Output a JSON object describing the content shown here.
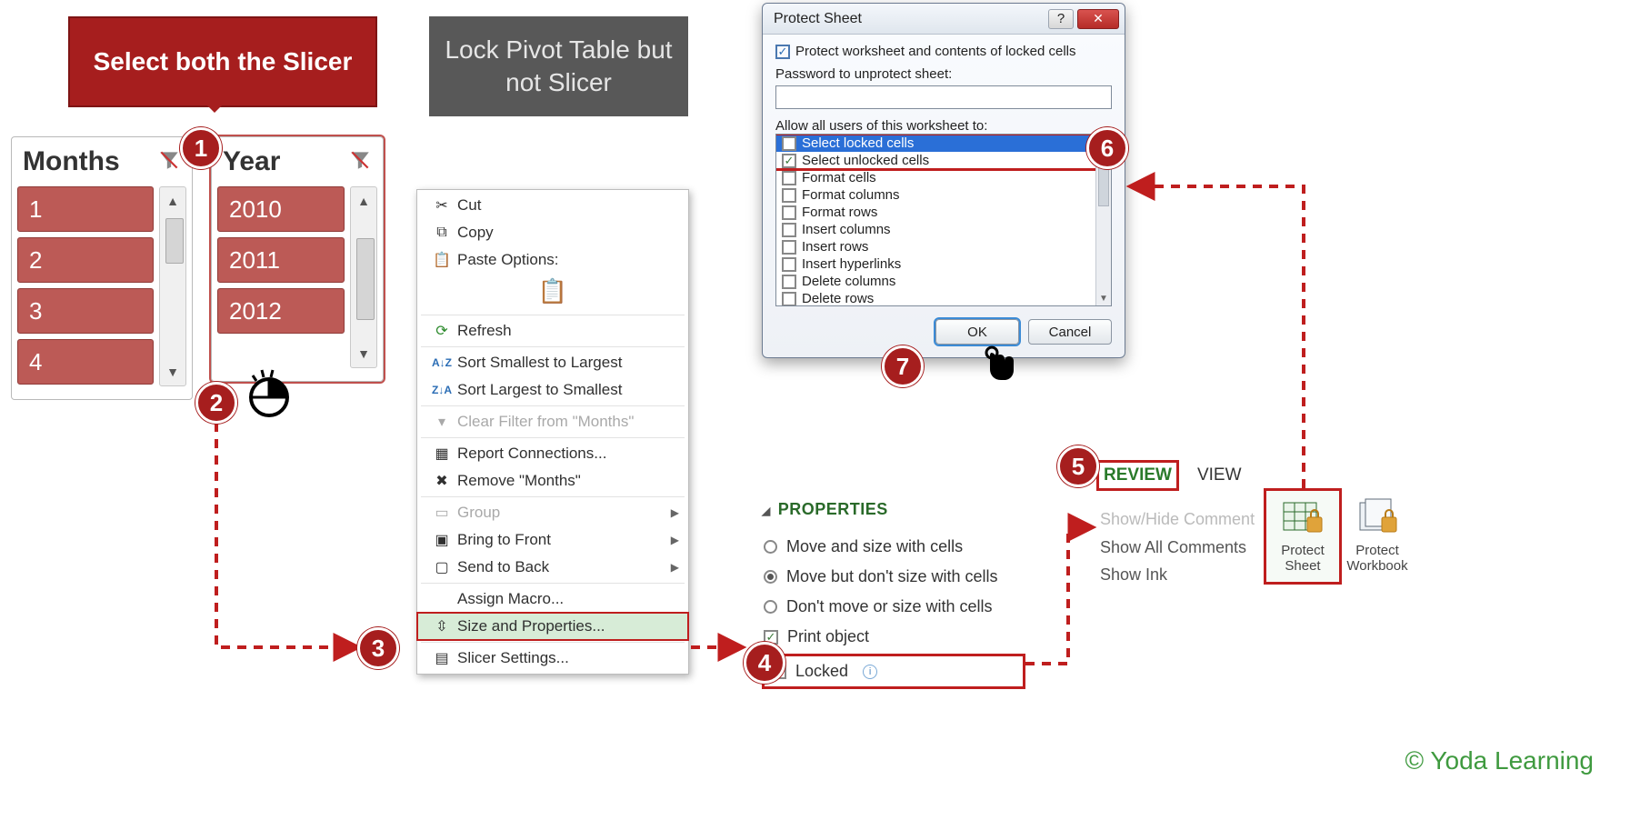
{
  "callout_text": "Select both the Slicer",
  "title_text": "Lock Pivot Table but not Slicer",
  "badges": {
    "b1": "1",
    "b2": "2",
    "b3": "3",
    "b4": "4",
    "b5": "5",
    "b6": "6",
    "b7": "7"
  },
  "slicer_months": {
    "title": "Months",
    "items": [
      "1",
      "2",
      "3",
      "4"
    ]
  },
  "slicer_year": {
    "title": "Year",
    "items": [
      "2010",
      "2011",
      "2012"
    ]
  },
  "context_menu": {
    "cut": "Cut",
    "copy": "Copy",
    "paste_options": "Paste Options:",
    "refresh": "Refresh",
    "sort_asc": "Sort Smallest to Largest",
    "sort_desc": "Sort Largest to Smallest",
    "clear_filter": "Clear Filter from \"Months\"",
    "report_conn": "Report Connections...",
    "remove": "Remove \"Months\"",
    "group": "Group",
    "front": "Bring to Front",
    "back": "Send to Back",
    "macro": "Assign Macro...",
    "sizeprops": "Size and Properties...",
    "slicer_settings": "Slicer Settings..."
  },
  "properties": {
    "header": "PROPERTIES",
    "opt1": "Move and size with cells",
    "opt2": "Move but don't size with cells",
    "opt3": "Don't move or size with cells",
    "print": "Print object",
    "locked": "Locked"
  },
  "ribbon": {
    "tab_review": "REVIEW",
    "tab_view": "VIEW",
    "c1": "Show/Hide Comment",
    "c2": "Show All Comments",
    "c3": "Show Ink",
    "protect_sheet": "Protect Sheet",
    "protect_workbook": "Protect Workbook"
  },
  "dialog": {
    "title": "Protect Sheet",
    "protect_chk": "Protect worksheet and contents of locked cells",
    "pw_label": "Password to unprotect sheet:",
    "allow_label": "Allow all users of this worksheet to:",
    "items": [
      "Select locked cells",
      "Select unlocked cells",
      "Format cells",
      "Format columns",
      "Format rows",
      "Insert columns",
      "Insert rows",
      "Insert hyperlinks",
      "Delete columns",
      "Delete rows"
    ],
    "ok": "OK",
    "cancel": "Cancel"
  },
  "attribution": "© Yoda Learning"
}
